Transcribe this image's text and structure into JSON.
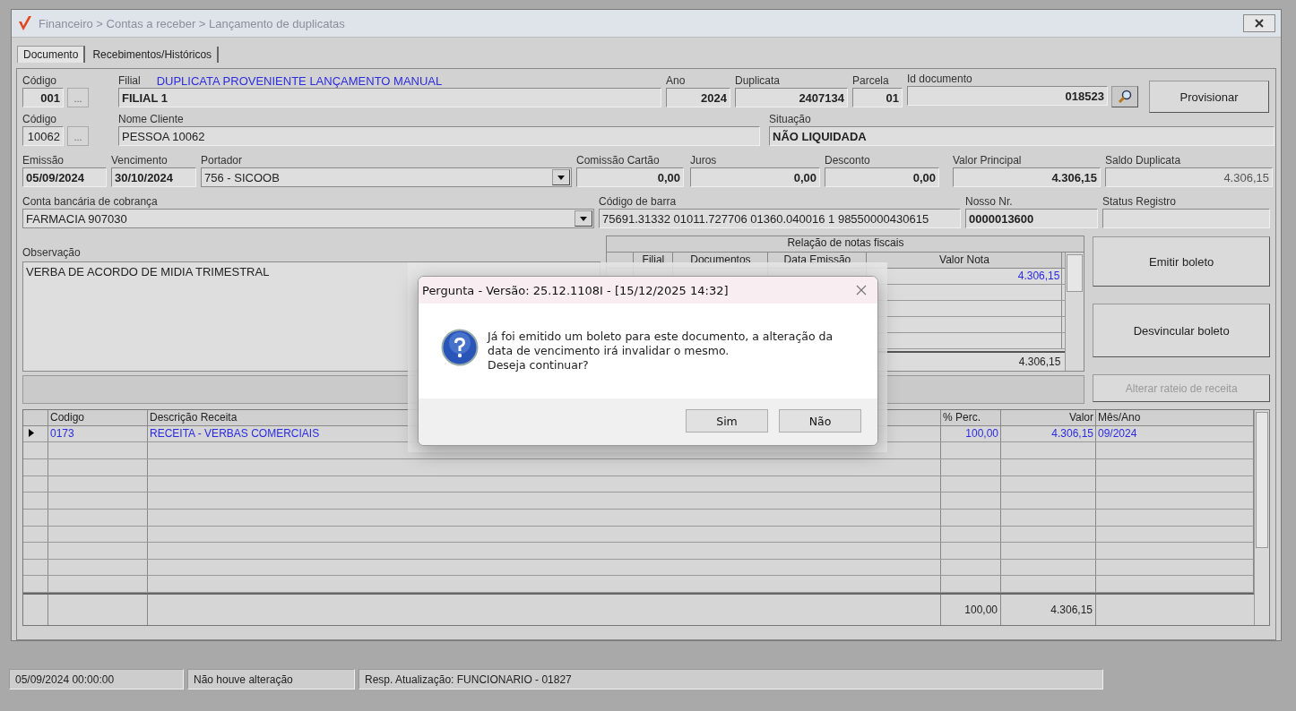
{
  "window": {
    "title": "Financeiro > Contas a receber > Lançamento de duplicatas"
  },
  "tabs": [
    {
      "label": "Documento",
      "selected": true
    },
    {
      "label": "Recebimentos/Históricos",
      "selected": false
    }
  ],
  "origin_note": "DUPLICATA PROVENIENTE LANÇAMENTO MANUAL",
  "fields": {
    "filial_code": {
      "label": "Código",
      "value": "001",
      "lookup": "..."
    },
    "filial": {
      "label": "Filial",
      "value": "FILIAL 1"
    },
    "ano": {
      "label": "Ano",
      "value": "2024"
    },
    "duplicata": {
      "label": "Duplicata",
      "value": "2407134"
    },
    "parcela": {
      "label": "Parcela",
      "value": "01"
    },
    "id_documento": {
      "label": "Id documento",
      "value": "018523"
    },
    "cliente_code": {
      "label": "Código",
      "value": "10062",
      "lookup": "..."
    },
    "cliente": {
      "label": "Nome Cliente",
      "value": "PESSOA 10062"
    },
    "situacao": {
      "label": "Situação",
      "value": "NÃO LIQUIDADA"
    },
    "emissao": {
      "label": "Emissão",
      "value": "05/09/2024"
    },
    "vencimento": {
      "label": "Vencimento",
      "value": "30/10/2024"
    },
    "portador": {
      "label": "Portador",
      "value": "756 - SICOOB"
    },
    "comissao": {
      "label": "Comissão Cartão",
      "value": "0,00"
    },
    "juros": {
      "label": "Juros",
      "value": "0,00"
    },
    "desconto": {
      "label": "Desconto",
      "value": "0,00"
    },
    "valor_principal": {
      "label": "Valor Principal",
      "value": "4.306,15"
    },
    "saldo": {
      "label": "Saldo Duplicata",
      "value": "4.306,15"
    },
    "conta": {
      "label": "Conta bancária de cobrança",
      "value": "FARMACIA 907030"
    },
    "codigo_barra": {
      "label": "Código de barra",
      "value": "75691.31332 01011.727706 01360.040016 1 98550000430615"
    },
    "nosso_nr": {
      "label": "Nosso Nr.",
      "value": "0000013600"
    },
    "status_registro": {
      "label": "Status Registro"
    },
    "observacao": {
      "label": "Observação",
      "value": "VERBA DE ACORDO DE MIDIA TRIMESTRAL"
    }
  },
  "buttons": [
    {
      "label": "Provisionar",
      "disabled": false
    },
    {
      "label": "Emitir boleto",
      "disabled": false
    },
    {
      "label": "Desvincular boleto",
      "disabled": false
    },
    {
      "label": "Alterar rateio de receita",
      "disabled": true
    }
  ],
  "notas_fiscais": {
    "title": "Relação de notas fiscais",
    "columns": [
      "Filial",
      "Documentos",
      "Data Emissão",
      "Valor Nota"
    ],
    "rows": [
      {
        "valor_nota": "4.306,15"
      }
    ],
    "total": "4.306,15"
  },
  "receitas": {
    "columns": [
      "Codigo",
      "Descrição Receita",
      "% Perc.",
      "Valor",
      "Mês/Ano"
    ],
    "rows": [
      {
        "selected": true,
        "cells": [
          "0173",
          "RECEITA - VERBAS COMERCIAIS",
          "100,00",
          "4.306,15",
          "09/2024"
        ]
      }
    ],
    "totals": {
      "perc": "100,00",
      "valor": "4.306,15"
    }
  },
  "status_bar": [
    "05/09/2024 00:00:00",
    "Não houve alteração",
    "Resp. Atualização: FUNCIONARIO - 01827"
  ],
  "dialog": {
    "title": "Pergunta - Versão: 25.12.1108I - [15/12/2025 14:32]",
    "message": "Já foi emitido um boleto para este documento, a alteração da\ndata de vencimento irá invalidar o mesmo.\nDeseja continuar?",
    "buttons": [
      "Sim",
      "Não"
    ]
  }
}
